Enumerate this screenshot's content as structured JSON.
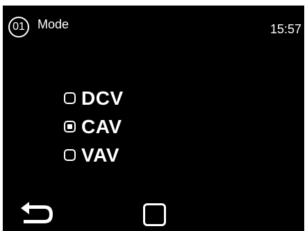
{
  "header": {
    "badge": "01",
    "title": "Mode",
    "clock": "15:57"
  },
  "options": [
    {
      "label": "DCV",
      "selected": false
    },
    {
      "label": "CAV",
      "selected": true
    },
    {
      "label": "VAV",
      "selected": false
    }
  ],
  "nav": {
    "back_icon": "return-arrow-icon",
    "home_icon": "square-icon"
  },
  "colors": {
    "screen_bg": "#000000",
    "foreground": "#ffffff"
  }
}
